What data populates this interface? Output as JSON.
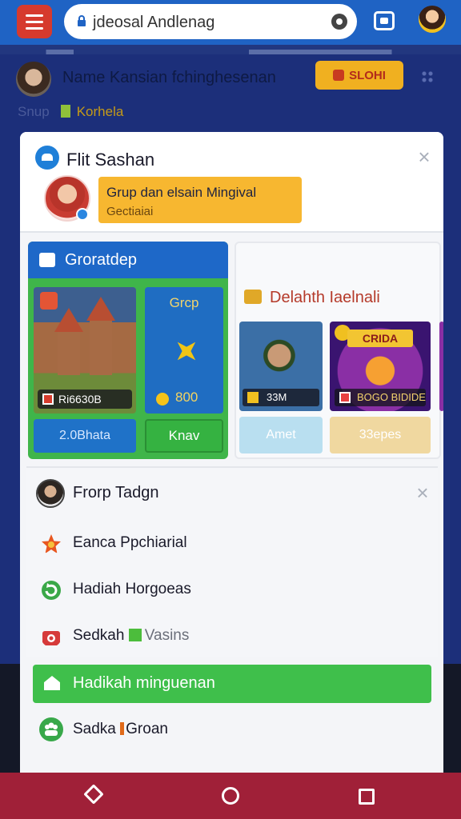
{
  "browser": {
    "url": "jdeosal Andlenag",
    "menu_icon": "hamburger-menu-icon",
    "tabs_icon": "tabs-icon",
    "colors": {
      "bar": "#1f63c4",
      "menu_button": "#d63a2e"
    }
  },
  "background_page": {
    "title": "Name Kansian fchinghesenan",
    "action_label": "SLOHI",
    "sub_label": "Snup",
    "sub_warning": "Korhela"
  },
  "card": {
    "title": "Flit Sashan",
    "notice_line1": "Grup dan elsain Mingival",
    "notice_line2": "Gectiaiai",
    "notice_color": "#f7b730"
  },
  "games_left": {
    "header": "Groratdep",
    "tile1_tag": "Ri6630B",
    "tile2_label": "Grcp",
    "tile2_count": "800",
    "button1": "2.0Bhata",
    "button2": "Knav"
  },
  "games_right": {
    "header": "Delahth Iaelnali",
    "tile1_tag": "33M",
    "tile2_title": "CRIDA",
    "tile2_tag": "BOGO BIDIDE",
    "button1": "Amet",
    "button2": "33epes"
  },
  "menu": {
    "header": "Frorp Tadgn",
    "items": [
      {
        "label": "Eanca Ppchiarial",
        "icon": "star-icon",
        "color": "#e8561f"
      },
      {
        "label": "Hadiah Horgoeas",
        "icon": "refresh-icon",
        "color": "#3aa848"
      },
      {
        "label": "Sedkah",
        "extra": "Vasins",
        "icon": "gift-icon",
        "color": "#d63a3a"
      }
    ],
    "primary_action": "Hadikah minguenan",
    "last_item": {
      "label": "Sadka",
      "extra": "Groan",
      "icon": "group-icon"
    }
  }
}
